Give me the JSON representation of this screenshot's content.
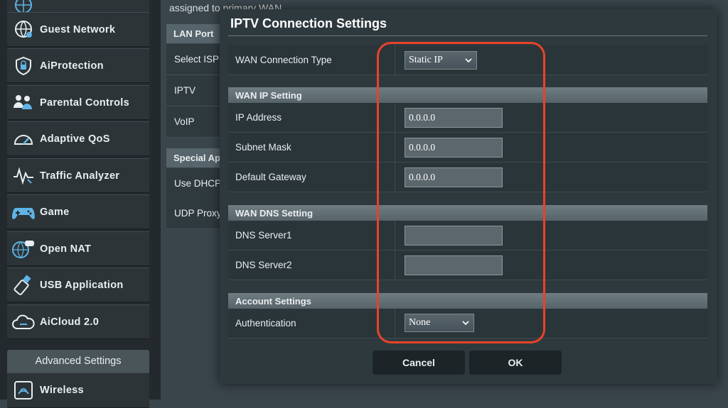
{
  "sidebar": {
    "items": [
      {
        "label": "",
        "icon": "globe-network-icon"
      },
      {
        "label": "Guest Network",
        "icon": "guest-network-icon"
      },
      {
        "label": "AiProtection",
        "icon": "shield-lock-icon"
      },
      {
        "label": "Parental Controls",
        "icon": "family-icon"
      },
      {
        "label": "Adaptive QoS",
        "icon": "speedometer-icon"
      },
      {
        "label": "Traffic Analyzer",
        "icon": "waveform-icon"
      },
      {
        "label": "Game",
        "icon": "gamepad-icon"
      },
      {
        "label": "Open NAT",
        "icon": "globe-gamepad-icon"
      },
      {
        "label": "USB Application",
        "icon": "usb-icon"
      },
      {
        "label": "AiCloud 2.0",
        "icon": "cloud-icon"
      }
    ],
    "advanced_header": "Advanced Settings",
    "wireless": {
      "label": "Wireless",
      "icon": "wifi-icon"
    }
  },
  "background": {
    "assigned_text": "assigned to primary WAN",
    "lan_port_header": "LAN Port",
    "rows": [
      "Select ISP",
      "IPTV",
      "VoIP"
    ],
    "special_header": "Special Ap",
    "rows2": [
      "Use DHCP",
      "UDP Proxy"
    ]
  },
  "modal": {
    "title": "IPTV Connection Settings",
    "wan_connection_type": {
      "label": "WAN Connection Type",
      "value": "Static IP"
    },
    "wan_ip_setting": {
      "header": "WAN IP Setting",
      "ip_address": {
        "label": "IP Address",
        "value": "0.0.0.0"
      },
      "subnet_mask": {
        "label": "Subnet Mask",
        "value": "0.0.0.0"
      },
      "default_gateway": {
        "label": "Default Gateway",
        "value": "0.0.0.0"
      }
    },
    "wan_dns_setting": {
      "header": "WAN DNS Setting",
      "dns1": {
        "label": "DNS Server1",
        "value": ""
      },
      "dns2": {
        "label": "DNS Server2",
        "value": ""
      }
    },
    "account_settings": {
      "header": "Account Settings",
      "authentication": {
        "label": "Authentication",
        "value": "None"
      }
    },
    "cancel_label": "Cancel",
    "ok_label": "OK"
  },
  "colors": {
    "highlight": "#e8432a",
    "accent_icon": "#5fb3e6"
  }
}
